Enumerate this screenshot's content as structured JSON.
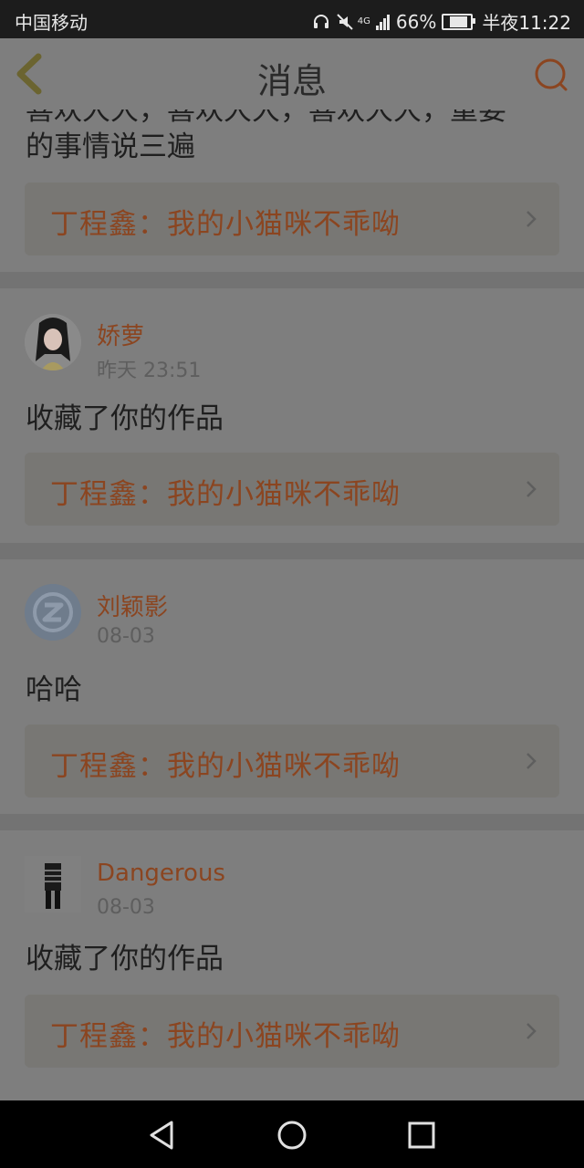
{
  "status_bar": {
    "carrier": "中国移动",
    "network": "4G",
    "battery": "66%",
    "battery_level": 0.66,
    "time": "半夜11:22"
  },
  "header": {
    "title": "消息",
    "back_icon": "chevron-left-icon",
    "search_icon": "search-icon"
  },
  "messages": [
    {
      "comment": "的事情说三遍",
      "comment_partial_top": "喜欢大大，喜欢大大，喜欢大大，重要",
      "reference": "丁程鑫：我的小猫咪不乖呦"
    },
    {
      "user": "娇萝",
      "time": "昨天 23:51",
      "comment": "收藏了你的作品",
      "reference": "丁程鑫：我的小猫咪不乖呦"
    },
    {
      "user": "刘颖影",
      "time": "08-03",
      "comment": "哈哈",
      "reference": "丁程鑫：我的小猫咪不乖呦"
    },
    {
      "user": "Dangerous",
      "time": "08-03",
      "comment": "收藏了你的作品",
      "reference": "丁程鑫：我的小猫咪不乖呦"
    }
  ],
  "colors": {
    "accent": "#8b4520",
    "header_bg": "#7e7e7e",
    "status_bg": "#1c1c1c"
  }
}
